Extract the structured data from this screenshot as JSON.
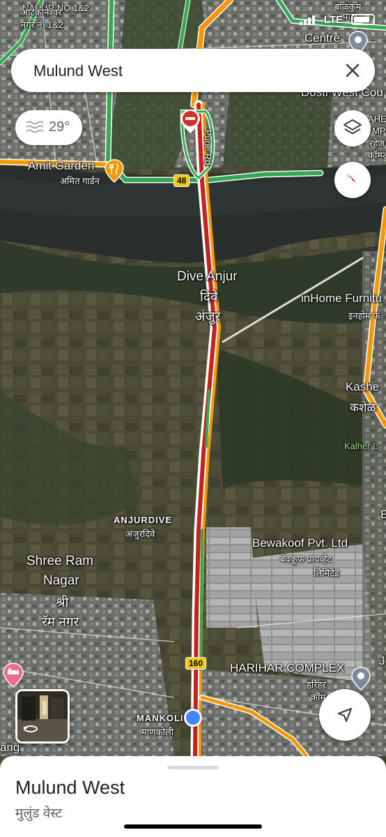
{
  "status": {
    "network": "LTE"
  },
  "search": {
    "query": "Mulund West"
  },
  "weather": {
    "temperature": "29°"
  },
  "map_labels": {
    "nahur_top": "NAHUR NO 1&2",
    "nahur_marathi1": "आटकोनेश्वर",
    "nahur_marathi2": "नगर नं. 1&2",
    "balkum": "बाळकुम",
    "balkum2": "पाडा",
    "centre": "Centre",
    "dosti": "Dosti West Cou",
    "amit_garden": "Amit Garden",
    "amit_garden_mr": "अमित गार्डन",
    "pune_rd": "Pune Rd",
    "highway_48": "48",
    "dive_anjur": "Dive Anjur",
    "dive_mr": "दिवे",
    "anjur_mr": "अंजुर",
    "inhome": "inHome Furnitu",
    "inhome_mr": "इनहोम फ",
    "kashe": "Kashe",
    "kashe_mr": "कशेळ",
    "kalher": "Kalher L",
    "anjurdive": "ANJURDIVE",
    "anjurdive_mr": "अंजुरदिवे",
    "bewakoof": "Bewakoof Pvt. Ltd",
    "bewakoof_mr1": "बेवकूफ प्रायव्हेट",
    "bewakoof_mr2": "लिमिटेड",
    "shree_ram1": "Shree Ram",
    "shree_ram2": "Nagar",
    "shree_mr": "श्री",
    "ram_nagar_mr": "रॅम नगर",
    "highway_160": "160",
    "harihar": "HARIHAR COMPLEX",
    "harihar_mr1": "हरिहर",
    "harihar_mr2": "कॉम्",
    "mankoli": "MANKOLI",
    "mankoli_mr": "माणकोली",
    "ang": "ang",
    "rehe": "रहेज",
    "complex_mr": "कॉम्प्ले",
    "ahe": "AHE",
    "mp": "MP",
    "j": "J",
    "e": "E"
  },
  "place_sheet": {
    "title": "Mulund West",
    "subtitle": "मुलुंड वेस्ट"
  },
  "icons": {
    "close": "close-icon",
    "layers": "layers-icon",
    "compass": "compass-icon",
    "locate": "navigation-arrow-icon",
    "weather": "haze-icon",
    "restaurant": "fork-knife-icon",
    "hotel": "bed-icon",
    "transit": "transit-pin-icon",
    "street_view": "360-rotate-icon"
  },
  "colors": {
    "traffic_red": "#c5221f",
    "traffic_orange": "#f29900",
    "traffic_green": "#34a853",
    "location_blue": "#4285f4",
    "highway_shield": "#f5c518"
  }
}
